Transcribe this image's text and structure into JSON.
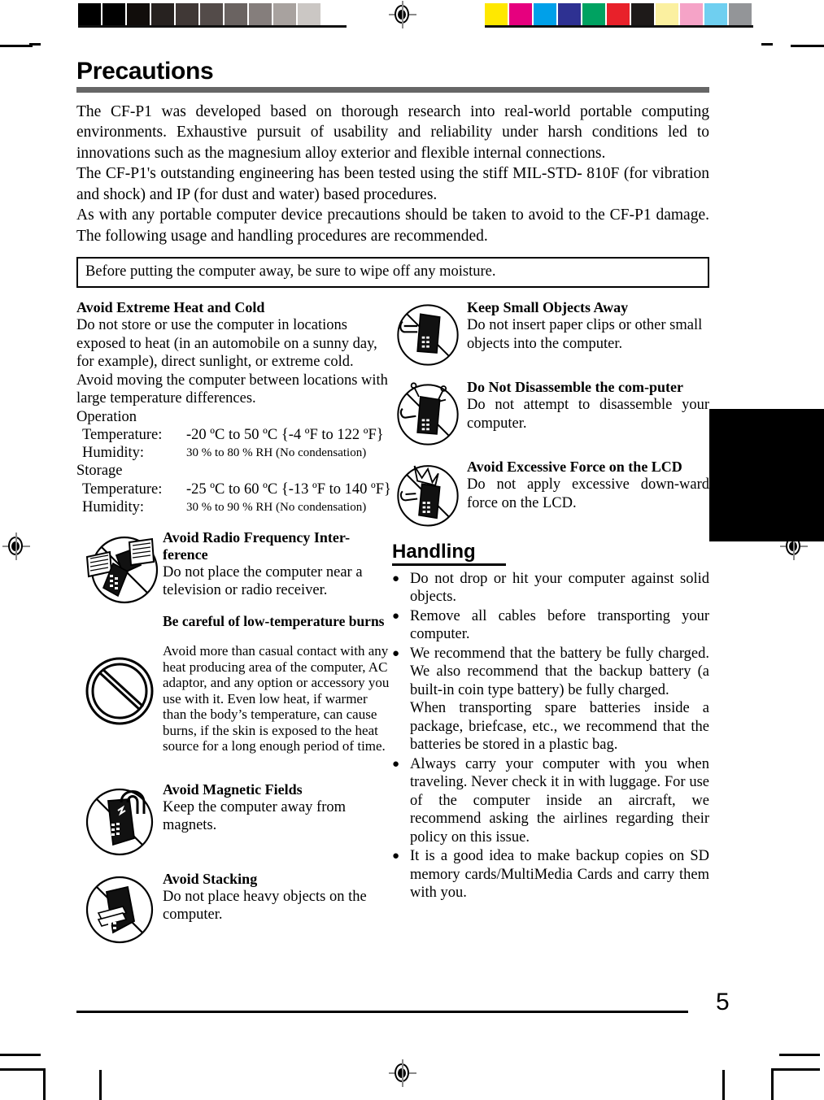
{
  "calibration": {
    "grayscale_swatches": [
      "#000000",
      "#010101",
      "#110d0b",
      "#272220",
      "#403836",
      "#534b49",
      "#6a6361",
      "#857e7c",
      "#a8a29f",
      "#cbc7c4",
      "#ffffff"
    ],
    "color_swatches": [
      "#ffe800",
      "#e6007e",
      "#00a0e9",
      "#2e3192",
      "#00a261",
      "#e8212a",
      "#1e1a19",
      "#fbf0a0",
      "#f5a3c7",
      "#6fcff0",
      "#939598"
    ],
    "registration_mark": "registration-target"
  },
  "header": {
    "title": "Precautions"
  },
  "intro": {
    "paragraph_1": "The CF-P1 was developed based on thorough research into real-world portable computing environments. Exhaustive pursuit of usability and reliability under harsh conditions led to innovations such as the magnesium alloy exterior and flexible internal connections.",
    "paragraph_2": "The CF-P1's outstanding engineering has been tested using the stiff MIL-STD- 810F (for vibration and shock) and IP (for dust and water) based procedures.",
    "paragraph_3": "As with any portable computer device precautions should be taken to avoid to the CF-P1 damage. The following usage and handling procedures are recommended."
  },
  "notice": {
    "text": "Before putting the computer away, be sure to wipe off any moisture."
  },
  "left_column": {
    "heat_cold": {
      "heading": "Avoid Extreme Heat and Cold",
      "body_1": "Do not store or use the computer in locations exposed to heat (in an automobile on a sunny day, for example), direct sunlight, or extreme cold.",
      "body_2": "Avoid moving the computer between locations with large temperature differences.",
      "operation_label": "Operation",
      "operation_temperature_key": "Temperature:",
      "operation_temperature_value": "-20 ºC to 50 ºC {-4 ºF to 122 ºF}",
      "operation_humidity_key": "Humidity:",
      "operation_humidity_value": "30 % to 80 % RH (No condensation)",
      "storage_label": "Storage",
      "storage_temperature_key": "Temperature:",
      "storage_temperature_value": "-25 ºC to 60 ºC {-13 ºF to 140 ºF}",
      "storage_humidity_key": "Humidity:",
      "storage_humidity_value": "30 % to 90 % RH (No condensation)"
    },
    "rf": {
      "heading": "Avoid Radio Frequency Inter-ference",
      "body": "Do not place the computer near a television or radio receiver.",
      "icon": "no-radio-frequency-icon"
    },
    "burns": {
      "heading": "Be careful of low-temperature burns",
      "body": "Avoid more than casual contact with any heat producing area of the computer, AC adaptor, and any option or accessory you use with it. Even low heat, if warmer than the body’s temperature, can cause burns, if the skin is exposed to the heat source for a long enough period of time.",
      "icon": "prohibition-circle-icon"
    },
    "magnetic": {
      "heading": "Avoid Magnetic Fields",
      "body": "Keep the computer away from magnets.",
      "icon": "no-magnet-icon"
    },
    "stacking": {
      "heading": "Avoid Stacking",
      "body": "Do not place heavy objects on the computer.",
      "icon": "no-stacking-icon"
    }
  },
  "right_column": {
    "small_objects": {
      "heading": "Keep Small Objects Away",
      "body": "Do not insert paper clips or other small objects into the computer.",
      "icon": "no-small-objects-icon"
    },
    "disassemble": {
      "heading": "Do Not Disassemble the com-puter",
      "body": "Do not attempt to disassemble your computer.",
      "icon": "no-disassemble-icon"
    },
    "lcd_force": {
      "heading": "Avoid Excessive Force on the LCD",
      "body": "Do not apply excessive down-ward force on the LCD.",
      "icon": "no-lcd-force-icon"
    },
    "handling": {
      "heading": "Handling",
      "bullet_glyph": "●",
      "bullets": [
        "Do not drop or hit your computer against solid objects.",
        "Remove all cables before transporting your computer.",
        "We recommend that the battery be fully charged. We also recommend that the backup battery (a built-in coin type battery) be fully charged.",
        "Always carry your computer with you when traveling.  Never check it in with luggage. For use of the computer inside an aircraft, we recommend asking the airlines regarding their policy on this issue.",
        "It is a good idea to make backup copies on SD memory cards/MultiMedia Cards and carry them with you."
      ],
      "bullet_3_continuation": "When transporting spare batteries inside a package, briefcase, etc., we recommend that the batteries be stored in a plastic bag."
    }
  },
  "footer": {
    "page_number": "5"
  }
}
